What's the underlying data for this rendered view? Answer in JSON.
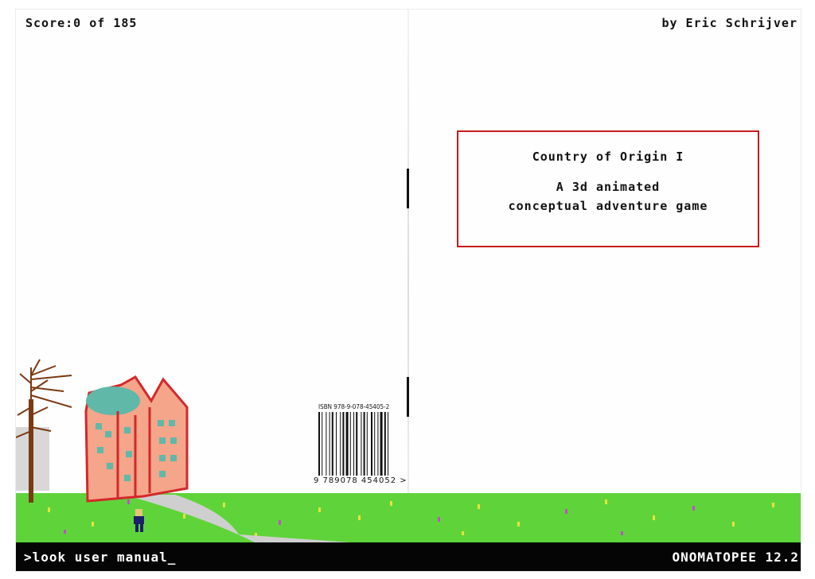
{
  "header": {
    "score_text": "Score:0 of 185",
    "author_text": "by Eric Schrijver"
  },
  "title_box": {
    "line1": "Country of Origin I",
    "line2": "A 3d animated",
    "line3": "conceptual adventure game"
  },
  "isbn": {
    "label": "ISBN 978-9-078-45405-2",
    "digits": "9 789078 454052 >"
  },
  "console": {
    "command": ">look user manual_",
    "publisher": "ONOMATOPEE 12.2"
  },
  "colors": {
    "grass": "#5fd43a",
    "building": "#f4a58a",
    "building_outline": "#d4282a",
    "dome": "#5fb8a8",
    "path": "#cfcfcf",
    "title_border": "#c81a1a"
  },
  "icons": [
    "tree-icon",
    "building-icon",
    "character-icon",
    "barcode-icon"
  ]
}
